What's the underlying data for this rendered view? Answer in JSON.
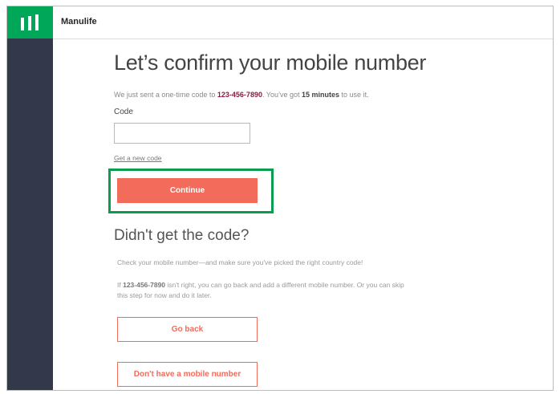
{
  "header": {
    "brand": "Manulife"
  },
  "main": {
    "title": "Let’s confirm your mobile number",
    "info_prefix": "We just sent a one-time code to ",
    "phone": "123-456-7890",
    "info_mid": ". You’ve got ",
    "minutes": "15 minutes",
    "info_suffix": " to use it.",
    "code_label": "Code",
    "code_value": "",
    "new_code_link": "Get a new code",
    "continue_label": "Continue",
    "help_title": "Didn't get the code?",
    "help_text_1": "Check your mobile number—and make sure you've picked the right country code!",
    "help_text_2_prefix": "If ",
    "help_text_2_phone": "123-456-7890",
    "help_text_2_suffix": " isn't right, you can go back and add a different mobile number. Or you can skip this step for now and do it later.",
    "go_back_label": "Go back",
    "no_mobile_label": "Don't have a mobile number"
  },
  "colors": {
    "accent": "#f26b5b",
    "brand_green": "#00a758",
    "rail": "#34384b",
    "highlight": "#0a9d4f"
  },
  "icons": {
    "logo": "manulife-m-logo-icon"
  }
}
